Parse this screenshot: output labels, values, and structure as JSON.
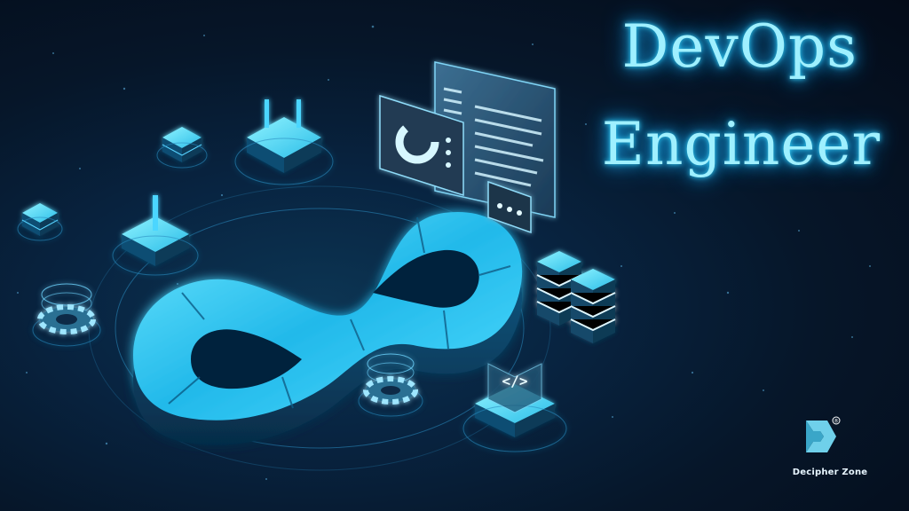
{
  "title": {
    "line1": "DevOps",
    "line2": "Engineer"
  },
  "brand": {
    "name": "Decipher Zone",
    "registered_mark": "®"
  },
  "colors": {
    "background": "#061629",
    "glow": "#35d8ff",
    "infinity": "#2bc8f2",
    "title_text": "#9ff0ff"
  },
  "icons": [
    "infinity-loop",
    "server-stack-icon",
    "gear-icon",
    "dashboard-window-icon",
    "chat-bubble-icon",
    "code-tag-icon",
    "data-block-icon",
    "power-plug-icon"
  ]
}
